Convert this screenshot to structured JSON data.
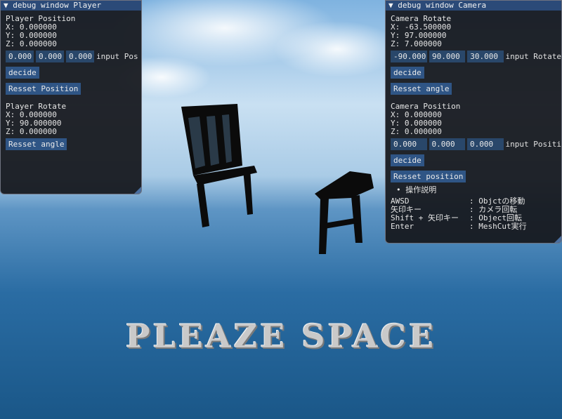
{
  "player_window": {
    "title": "debug window Player",
    "position_header": "Player Position",
    "pos_x": "X: 0.000000",
    "pos_y": "Y: 0.000000",
    "pos_z": "Z: 0.000000",
    "pos_inputs": [
      "0.000",
      "0.000",
      "0.000"
    ],
    "pos_input_label": "input Pos",
    "decide_label": "decide",
    "reset_position_label": "Resset Position",
    "rotate_header": "Player Rotate",
    "rot_x": "X: 0.000000",
    "rot_y": "Y: 90.000000",
    "rot_z": "Z: 0.000000",
    "reset_angle_label": "Resset angle"
  },
  "camera_window": {
    "title": "debug window Camera",
    "rotate_header": "Camera Rotate",
    "rot_x": "X: -63.500000",
    "rot_y": "Y: 97.000000",
    "rot_z": "Z: 7.000000",
    "rot_inputs": [
      "-90.000",
      "90.000",
      "30.000"
    ],
    "rot_input_label": "input Rotate",
    "decide_label": "decide",
    "reset_angle_label": "Resset angle",
    "position_header": "Camera Position",
    "pos_x": "X: 0.000000",
    "pos_y": "Y: 0.000000",
    "pos_z": "Z: 0.000000",
    "pos_inputs": [
      "0.000",
      "0.000",
      "0.000"
    ],
    "pos_input_label": "input Positi",
    "decide2_label": "decide",
    "reset_position_label": "Resset position",
    "help_header": "操作説明",
    "help": [
      {
        "key": "AWSD",
        "desc": ": Objctの移動"
      },
      {
        "key": "矢印キー",
        "desc": ": カメラ回転"
      },
      {
        "key": "Shift + 矢印キー",
        "desc": ": Object回転"
      },
      {
        "key": "Enter",
        "desc": ": MeshCut実行"
      }
    ]
  },
  "overlay": {
    "press_text": "PLEAZE SPACE"
  },
  "colors": {
    "title_bar": "#2b4a78",
    "button": "#2f5585",
    "field": "#29476a",
    "sea": "#1e5a8c"
  }
}
